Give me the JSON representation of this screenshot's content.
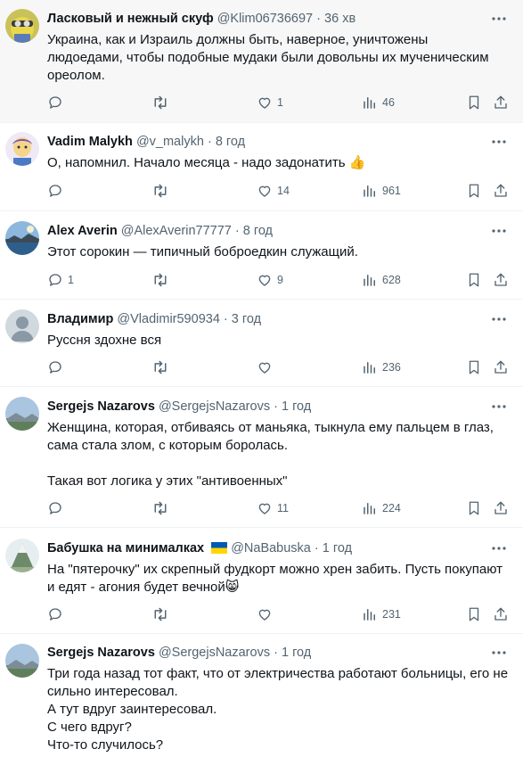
{
  "tweets": [
    {
      "name": "Ласковый и нежный скуф",
      "handle": "@Klim06736697",
      "dot": "·",
      "time": "36 хв",
      "lines": [
        "Украина, как и Израиль должны быть, наверное, уничтожены",
        "людоедами, чтобы подобные мудаки  были довольны их мученическим",
        "ореолом."
      ],
      "counts": {
        "reply": "",
        "retweet": "",
        "like": "1",
        "views": "46"
      }
    },
    {
      "name": "Vadim Malykh",
      "handle": "@v_malykh",
      "dot": "·",
      "time": "8 год",
      "lines": [
        "О, напомнил. Начало месяца - надо задонатить 👍"
      ],
      "counts": {
        "reply": "",
        "retweet": "",
        "like": "14",
        "views": "961"
      }
    },
    {
      "name": "Alex Averin",
      "handle": "@AlexAverin77777",
      "dot": "·",
      "time": "8 год",
      "lines": [
        "Этот сорокин — типичный боброедкин служащий."
      ],
      "counts": {
        "reply": "1",
        "retweet": "",
        "like": "9",
        "views": "628"
      }
    },
    {
      "name": "Владимир",
      "handle": "@Vladimir590934",
      "dot": "·",
      "time": "3 год",
      "lines": [
        "Руссня здохне вся"
      ],
      "counts": {
        "reply": "",
        "retweet": "",
        "like": "",
        "views": "236"
      }
    },
    {
      "name": "Sergejs Nazarovs",
      "handle": "@SergejsNazarovs",
      "dot": "·",
      "time": "1 год",
      "lines": [
        "Женщина, которая, отбиваясь от маньяка, тыкнула ему пальцем в глаз,",
        "сама стала злом, с которым боролась.",
        "",
        "Такая вот логика у этих \"антивоенных\""
      ],
      "counts": {
        "reply": "",
        "retweet": "",
        "like": "11",
        "views": "224"
      }
    },
    {
      "name": "Бабушка на минималках",
      "handle": "@NaBabuska",
      "dot": "·",
      "time": "1 год",
      "lines": [
        "На \"пятерочку\" их скрепный фудкорт можно хрен забить. Пусть покупают",
        "и едят - агония будет вечной😸"
      ],
      "counts": {
        "reply": "",
        "retweet": "",
        "like": "",
        "views": "231"
      }
    },
    {
      "name": "Sergejs Nazarovs",
      "handle": "@SergejsNazarovs",
      "dot": "·",
      "time": "1 год",
      "lines": [
        "Три года назад тот факт, что от электричества работают больницы, его не",
        "сильно интересовал.",
        "А тут вдруг заинтересовал.",
        "С чего вдруг?",
        "Что-то случилось?"
      ],
      "counts": {}
    }
  ],
  "icons": [
    "more-dots-icon",
    "reply-icon",
    "retweet-icon",
    "like-icon",
    "views-icon",
    "bookmark-icon",
    "share-icon"
  ],
  "colors": {
    "text": "#0f1419",
    "secondary": "#536471",
    "divider": "#eff3f4",
    "highlight_bg": "#f7f7f7",
    "flag_blue": "#0057b7",
    "flag_yellow": "#ffd700"
  }
}
